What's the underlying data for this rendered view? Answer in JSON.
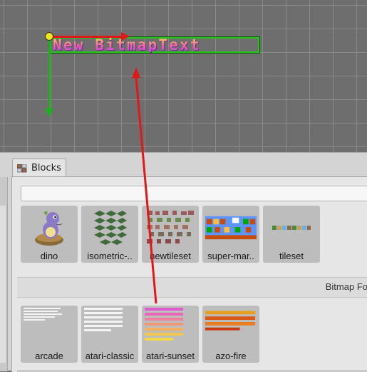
{
  "scene": {
    "bitmap_text": "New BitmapText"
  },
  "panel": {
    "tab_label": "Blocks",
    "search_placeholder": "",
    "row1": [
      {
        "name": "dino",
        "icon": "dino-thumbnail"
      },
      {
        "name": "isometric-..",
        "icon": "isometric-tiles-thumbnail"
      },
      {
        "name": "newtileset",
        "icon": "tileset-thumbnail"
      },
      {
        "name": "super-mar..",
        "icon": "mario-tiles-thumbnail"
      },
      {
        "name": "tileset",
        "icon": "small-tileset-thumbnail"
      }
    ],
    "section_title": "Bitmap Fo",
    "row2": [
      {
        "name": "arcade",
        "icon": "arcade-font-thumbnail"
      },
      {
        "name": "atari-classic",
        "icon": "atari-classic-font-thumbnail"
      },
      {
        "name": "atari-sunset",
        "icon": "atari-sunset-font-thumbnail"
      },
      {
        "name": "azo-fire",
        "icon": "azo-fire-font-thumbnail"
      }
    ]
  },
  "colors": {
    "axis_x": "#e01818",
    "axis_y": "#19b319",
    "selection": "#27c31d",
    "pointer_arrow": "#e01818"
  }
}
